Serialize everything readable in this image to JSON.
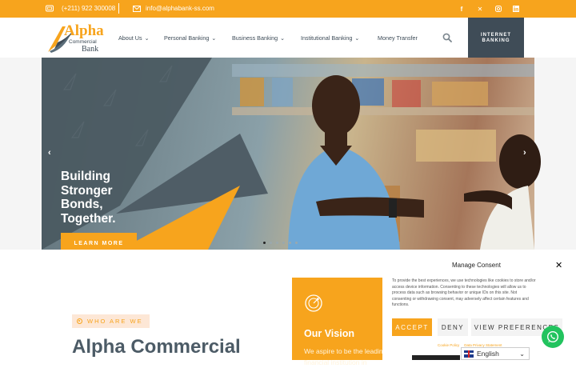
{
  "topbar": {
    "phone": "(+211) 922 300008",
    "email": "info@alphabank-ss.com",
    "socials": [
      "facebook-icon",
      "x-icon",
      "instagram-icon",
      "linkedin-icon"
    ]
  },
  "logo": {
    "alpha": "Alpha",
    "commercial": "Commercial",
    "bank": "Bank"
  },
  "nav": {
    "items": [
      {
        "label": "About Us",
        "has_dropdown": true
      },
      {
        "label": "Personal Banking",
        "has_dropdown": true
      },
      {
        "label": "Business Banking",
        "has_dropdown": true
      },
      {
        "label": "Institutional Banking",
        "has_dropdown": true
      },
      {
        "label": "Money Transfer",
        "has_dropdown": false
      }
    ],
    "internet_banking": "INTERNET BANKING"
  },
  "hero": {
    "headline": "Building Stronger Bonds, Together.",
    "cta": "LEARN MORE",
    "slide_count": 6,
    "active_slide": 1
  },
  "about": {
    "badge": "WHO ARE WE",
    "heading": "Alpha Commercial"
  },
  "vision": {
    "title": "Our Vision",
    "text": "We aspire to be the leading financial institution in"
  },
  "consent": {
    "title": "Manage Consent",
    "text": "To provide the best experiences, we use technologies like cookies to store and/or access device information. Consenting to these technologies will allow us to process data such as browsing behavior or unique IDs on this site. Not consenting or withdrawing consent, may adversely affect certain features and functions.",
    "accept": "ACCEPT",
    "deny": "DENY",
    "preferences": "VIEW PREFERENCES",
    "links": [
      "Cookie Policy",
      "Data Privacy Statement"
    ]
  },
  "language": {
    "selected": "English"
  },
  "colors": {
    "brand_orange": "#f7a41d",
    "brand_slate": "#3f4c57",
    "whatsapp": "#22c35e"
  }
}
